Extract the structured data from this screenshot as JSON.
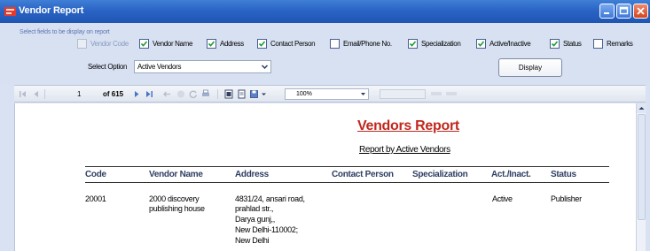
{
  "window": {
    "title": "Vendor Report"
  },
  "selection": {
    "hint": "Select fields to be display on report",
    "fields": [
      {
        "label": "Vendor Code",
        "checked": false,
        "enabled": false
      },
      {
        "label": "Vendor Name",
        "checked": true,
        "enabled": true
      },
      {
        "label": "Address",
        "checked": true,
        "enabled": true
      },
      {
        "label": "Contact Person",
        "checked": true,
        "enabled": true
      },
      {
        "label": "Email/Phone No.",
        "checked": false,
        "enabled": true
      },
      {
        "label": "Specialization",
        "checked": true,
        "enabled": true
      },
      {
        "label": "Active/Inactive",
        "checked": true,
        "enabled": true
      },
      {
        "label": "Status",
        "checked": true,
        "enabled": true
      },
      {
        "label": "Remarks",
        "checked": false,
        "enabled": true
      }
    ],
    "select_option_label": "Select Option",
    "select_option_value": "Active Vendors",
    "display_button": "Display"
  },
  "toolbar": {
    "current_page": "1",
    "page_of": "of 615",
    "zoom": "100%"
  },
  "report": {
    "title": "Vendors Report",
    "subtitle": "Report by Active Vendors",
    "columns": [
      "Code",
      "Vendor Name",
      "Address",
      "Contact Person",
      "Specialization",
      "Act./Inact.",
      "Status"
    ],
    "rows": [
      {
        "code": "20001",
        "vendor_name_1": "2000 discovery",
        "vendor_name_2": "publishing house",
        "address_1": "4831/24, ansari  road,",
        "address_2": "prahlad str.,",
        "address_3": "Darya gunj,,",
        "address_4": "New Delhi-110002;",
        "address_5": "New Delhi",
        "active": "Active",
        "status": "Publisher"
      }
    ]
  },
  "colors": {
    "title_bar": "#2a64c4",
    "report_title": "#c0281e",
    "header_text": "#2e3e62"
  }
}
